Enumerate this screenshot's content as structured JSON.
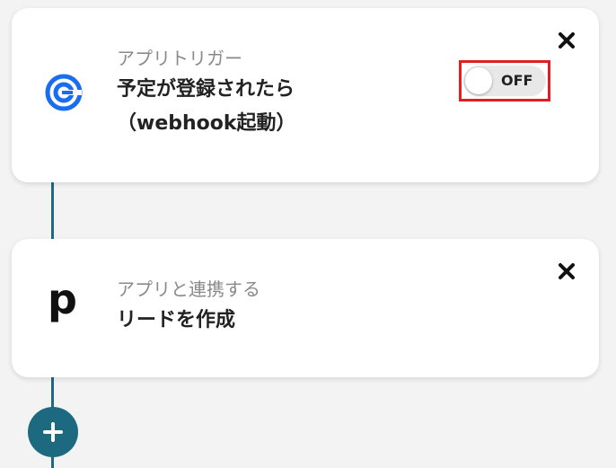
{
  "trigger": {
    "subtitle": "アプリトリガー",
    "title_line1": "予定が登録されたら",
    "title_line2": "（webhook起動）",
    "app_icon": "calendly-icon",
    "toggle": {
      "state": "OFF",
      "color_track": "#e8e8e8",
      "highlight": "#e02020"
    }
  },
  "action": {
    "subtitle": "アプリと連携する",
    "title": "リードを作成",
    "app_icon": "pipedrive-icon",
    "app_letter": "p"
  },
  "colors": {
    "accent": "#1d6a80",
    "calendly_blue": "#1a6cf0"
  },
  "icons": {
    "close": "close-icon",
    "add": "plus-icon"
  }
}
